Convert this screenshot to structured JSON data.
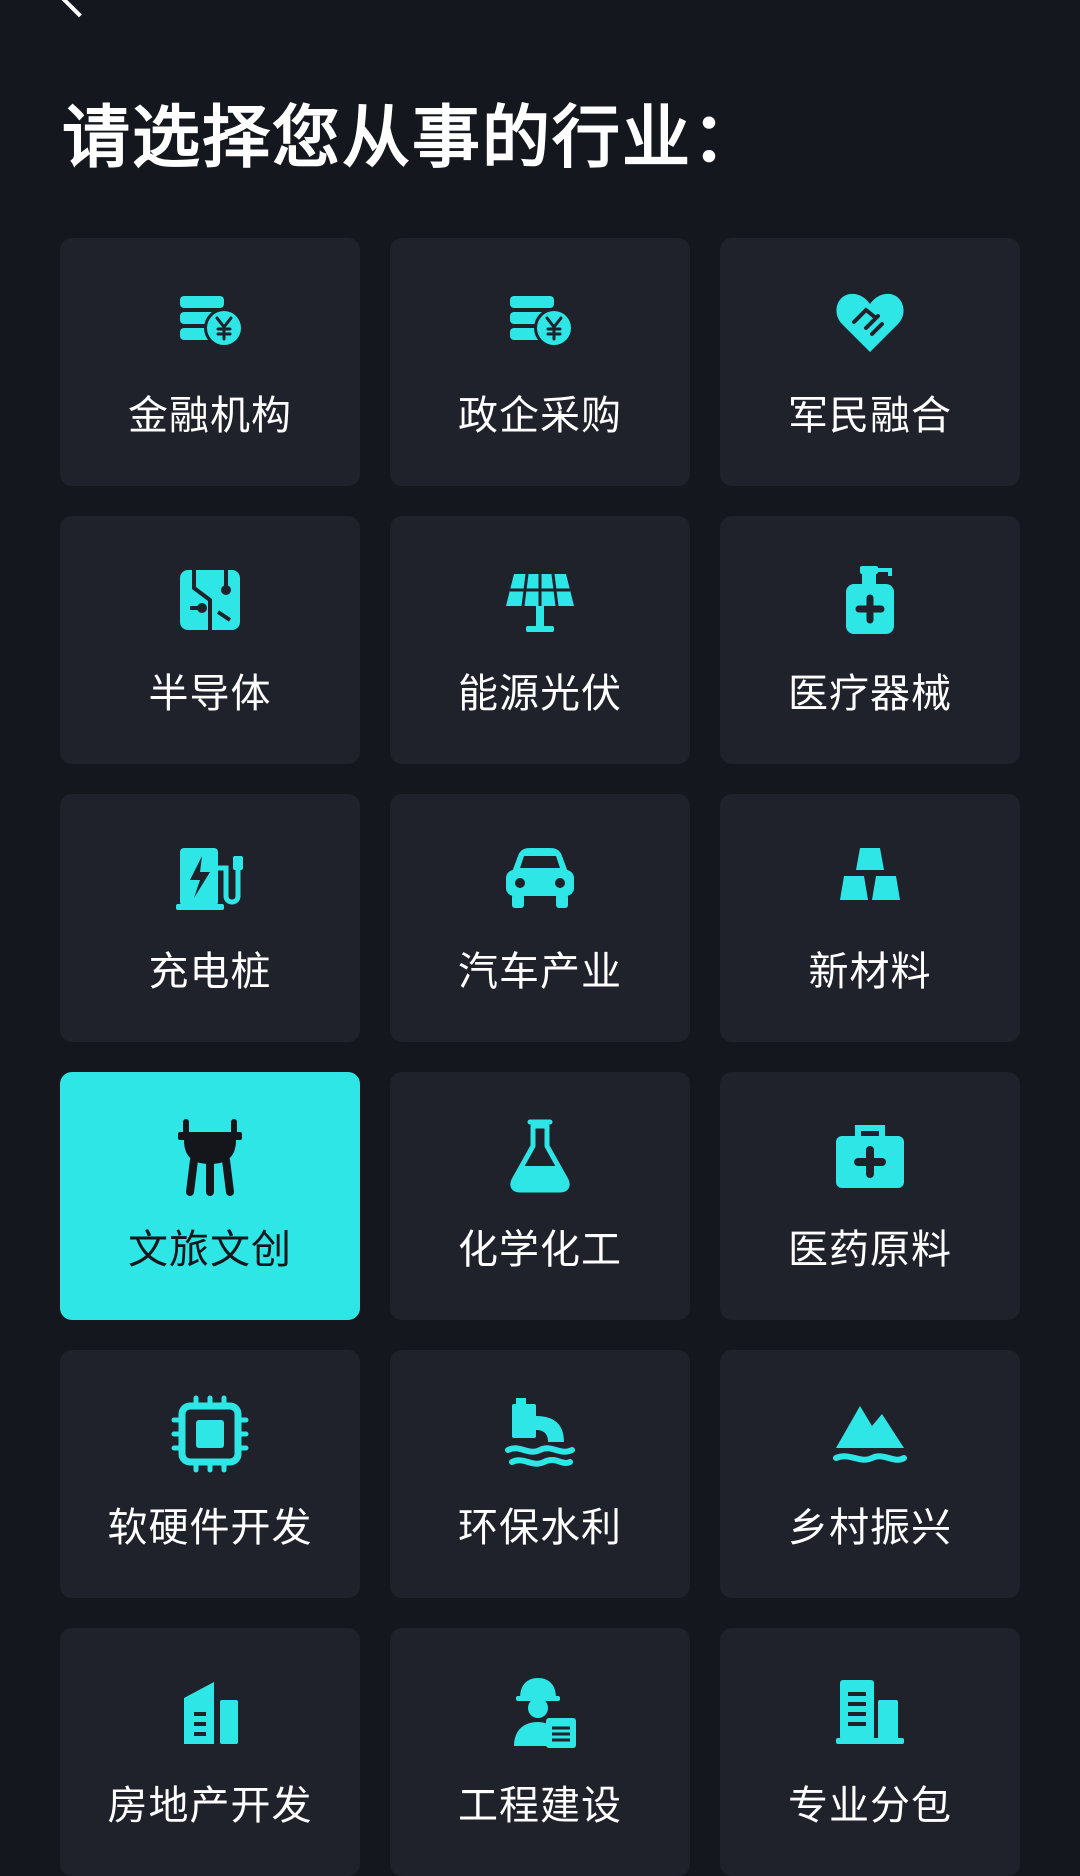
{
  "header": {
    "title": "请选择您从事的行业："
  },
  "colors": {
    "background": "#15171f",
    "tile": "#1f222b",
    "accent": "#2ee6e6",
    "selected_text": "#14161c"
  },
  "industries": [
    {
      "label": "金融机构",
      "icon": "coins-yen-icon",
      "selected": false
    },
    {
      "label": "政企采购",
      "icon": "coins-yen-icon",
      "selected": false
    },
    {
      "label": "军民融合",
      "icon": "heart-handshake-icon",
      "selected": false
    },
    {
      "label": "半导体",
      "icon": "circuit-chip-icon",
      "selected": false
    },
    {
      "label": "能源光伏",
      "icon": "solar-panel-icon",
      "selected": false
    },
    {
      "label": "医疗器械",
      "icon": "medical-bottle-icon",
      "selected": false
    },
    {
      "label": "充电桩",
      "icon": "charging-station-icon",
      "selected": false
    },
    {
      "label": "汽车产业",
      "icon": "car-icon",
      "selected": false
    },
    {
      "label": "新材料",
      "icon": "gold-bars-icon",
      "selected": false
    },
    {
      "label": "文旅文创",
      "icon": "ancient-cauldron-icon",
      "selected": true
    },
    {
      "label": "化学化工",
      "icon": "flask-icon",
      "selected": false
    },
    {
      "label": "医药原料",
      "icon": "medical-kit-icon",
      "selected": false
    },
    {
      "label": "软硬件开发",
      "icon": "cpu-chip-icon",
      "selected": false
    },
    {
      "label": "环保水利",
      "icon": "water-outlet-icon",
      "selected": false
    },
    {
      "label": "乡村振兴",
      "icon": "mountain-icon",
      "selected": false
    },
    {
      "label": "房地产开发",
      "icon": "building-icon",
      "selected": false
    },
    {
      "label": "工程建设",
      "icon": "engineer-icon",
      "selected": false
    },
    {
      "label": "专业分包",
      "icon": "office-building-icon",
      "selected": false
    }
  ]
}
